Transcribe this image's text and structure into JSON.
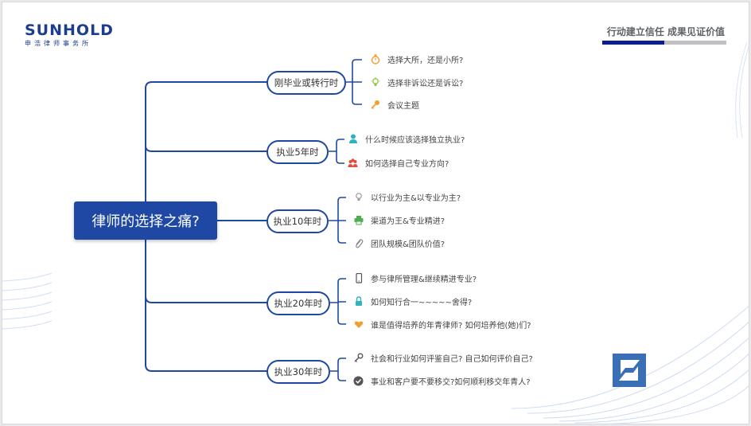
{
  "header": {
    "logo_text": "SUNHOLD",
    "logo_subtitle": "申浩律师事务所",
    "slogan": "行动建立信任 成果见证价值"
  },
  "mindmap": {
    "root": "律师的选择之痛?",
    "branches": [
      {
        "label": "刚毕业或转行时",
        "items": [
          {
            "text": "选择大所，还是小所?",
            "icon": "stopwatch-icon",
            "color": "#f0a030"
          },
          {
            "text": "选择非诉讼还是诉讼?",
            "icon": "lightbulb-icon",
            "color": "#8cc63f"
          },
          {
            "text": "会议主题",
            "icon": "key-icon",
            "color": "#f0a030"
          }
        ]
      },
      {
        "label": "执业5年时",
        "items": [
          {
            "text": "什么时候应该选择独立执业?",
            "icon": "person-icon",
            "color": "#2fb3c0"
          },
          {
            "text": "如何选择自己专业方向?",
            "icon": "group-icon",
            "color": "#e05040"
          }
        ]
      },
      {
        "label": "执业10年时",
        "items": [
          {
            "text": "以行业为主&以专业为主?",
            "icon": "lightbulb-icon",
            "color": "#999999"
          },
          {
            "text": "渠道为王&专业精进?",
            "icon": "printer-icon",
            "color": "#4cae4c"
          },
          {
            "text": "团队规模&团队价值?",
            "icon": "paperclip-icon",
            "color": "#888888"
          }
        ]
      },
      {
        "label": "执业20年时",
        "items": [
          {
            "text": "参与律所管理&继续精进专业?",
            "icon": "phone-icon",
            "color": "#555555"
          },
          {
            "text": "如何知行合一~~~~~舍得?",
            "icon": "lock-icon",
            "color": "#2fb3c0"
          },
          {
            "text": "谁是值得培养的年青律师? 如何培养他(她)们?",
            "icon": "heart-icon",
            "color": "#f0a030"
          }
        ]
      },
      {
        "label": "执业30年时",
        "items": [
          {
            "text": "社会和行业如何评鉴自己? 自己如何评价自己?",
            "icon": "key-icon",
            "color": "#555555"
          },
          {
            "text": "事业和客户要不要移交?如何顺利移交年青人?",
            "icon": "check-circle-icon",
            "color": "#555555"
          }
        ]
      }
    ]
  }
}
